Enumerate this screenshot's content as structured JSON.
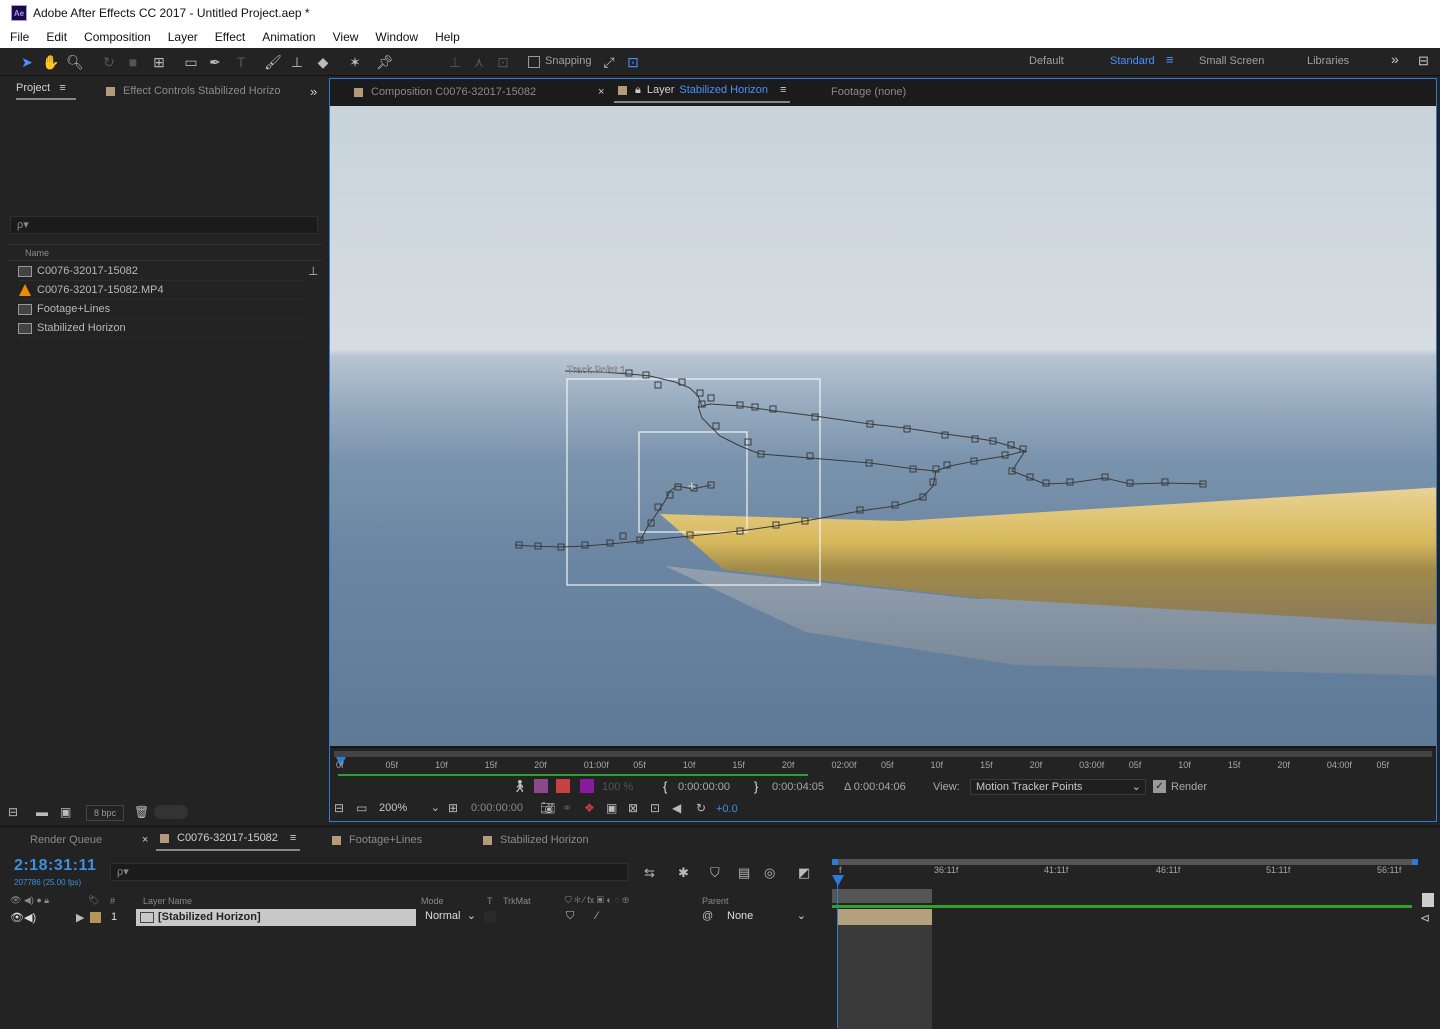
{
  "window": {
    "title": "Adobe After Effects CC 2017 - Untitled Project.aep *",
    "logo": "Ae"
  },
  "menu": [
    "File",
    "Edit",
    "Composition",
    "Layer",
    "Effect",
    "Animation",
    "View",
    "Window",
    "Help"
  ],
  "toolbar": {
    "snapping_label": "Snapping",
    "workspaces": [
      "Default",
      "Standard",
      "Small Screen",
      "Libraries"
    ],
    "active_workspace": "Standard",
    "overflow": "»"
  },
  "project_panel": {
    "tab_project": "Project",
    "tab_effect_controls": "Effect Controls Stabilized Horizo",
    "search_placeholder": "ρ▾",
    "column_name": "Name",
    "items": [
      {
        "name": "C0076-32017-15082",
        "icon": "composition-icon"
      },
      {
        "name": "C0076-32017-15082.MP4",
        "icon": "vlc-cone-icon"
      },
      {
        "name": "Footage+Lines",
        "icon": "composition-icon"
      },
      {
        "name": "Stabilized Horizon",
        "icon": "composition-icon"
      }
    ],
    "bpc": "8 bpc"
  },
  "viewer": {
    "tab_composition": "Composition C0076-32017-15082",
    "tab_layer_prefix": "Layer",
    "tab_layer_name": "Stabilized Horizon",
    "tab_footage": "Footage (none)",
    "track_point_label": "Track Point 1",
    "ruler_ticks": [
      "0f",
      "05f",
      "10f",
      "15f",
      "20f",
      "01:00f",
      "05f",
      "10f",
      "15f",
      "20f",
      "02:00f",
      "05f",
      "10f",
      "15f",
      "20f",
      "03:00f",
      "05f",
      "10f",
      "15f",
      "20f",
      "04:00f",
      "05f"
    ],
    "in_time": "0:00:00:00",
    "out_time": "0:00:04:05",
    "duration": "Δ 0:00:04:06",
    "view_label": "View:",
    "view_value": "Motion Tracker Points",
    "render_label": "Render",
    "zoom": "200%",
    "current_time": "0:00:00:00",
    "exposure": "+0.0",
    "opacity": "100 %"
  },
  "timeline": {
    "tabs": [
      "Render Queue",
      "C0076-32017-15082",
      "Footage+Lines",
      "Stabilized Horizon"
    ],
    "active_tab": "C0076-32017-15082",
    "timecode": "2:18:31:11",
    "frames": "207786 (25.00 fps)",
    "search_placeholder": "ρ▾",
    "columns": {
      "num": "#",
      "layer_name": "Layer Name",
      "mode": "Mode",
      "t": "T",
      "trkmat": "TrkMat",
      "parent": "Parent"
    },
    "layer": {
      "index": "1",
      "name": "[Stabilized Horizon]",
      "mode": "Normal",
      "parent": "None"
    },
    "ruler_ticks": [
      "36:11f",
      "41:11f",
      "46:11f",
      "51:11f",
      "56:11f"
    ],
    "start_tick": "f"
  },
  "colors": {
    "accent": "#2d7bd6",
    "timecode": "#3d8fe0",
    "track": "#d7b85b"
  }
}
